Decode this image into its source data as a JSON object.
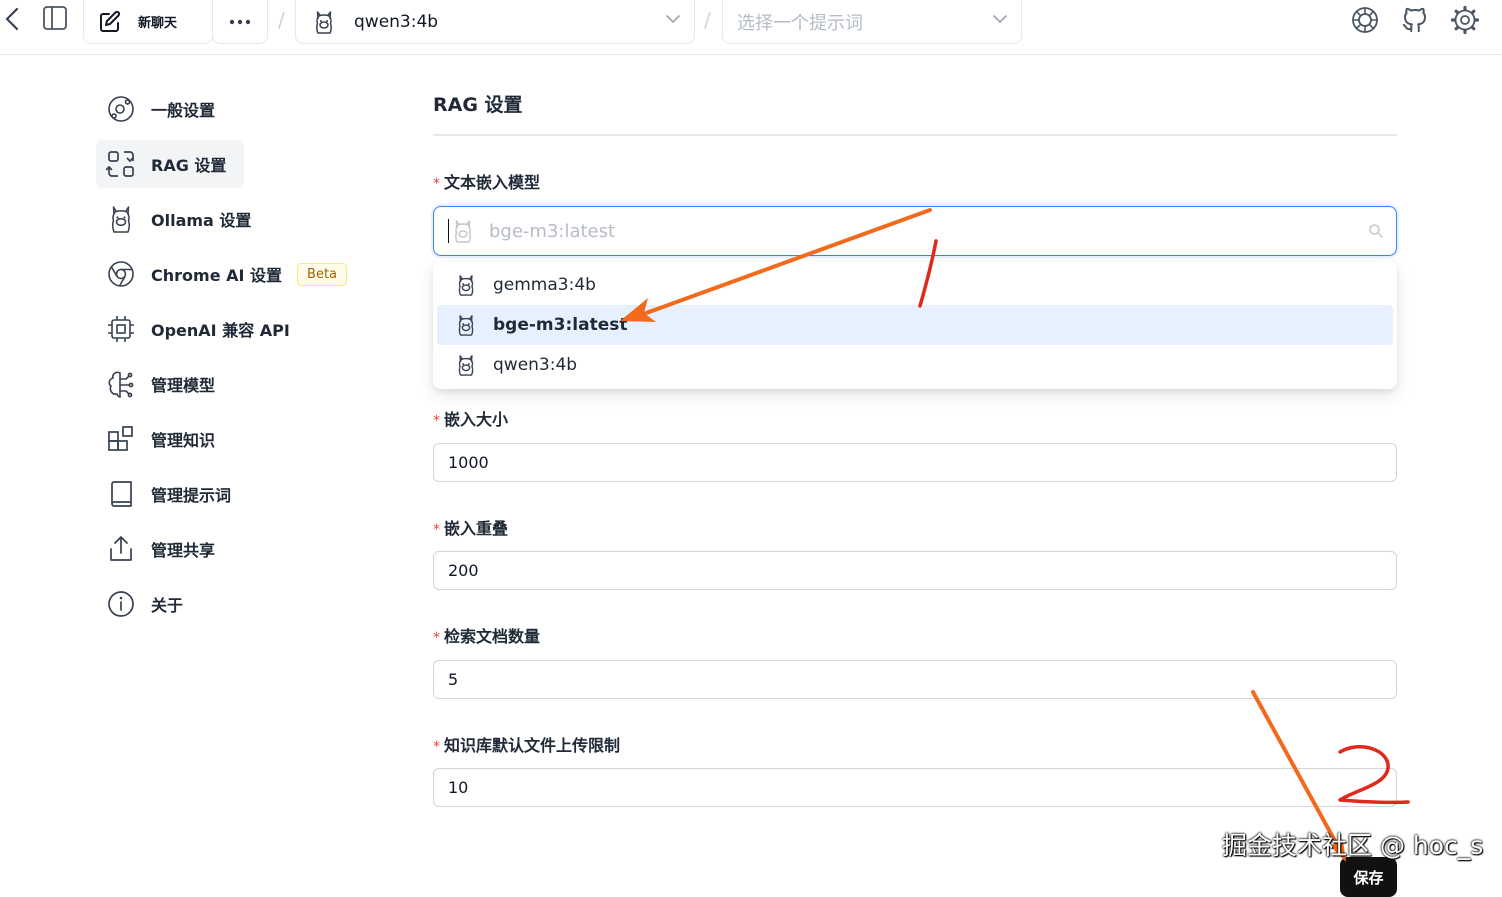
{
  "topbar": {
    "new_chat_label": "新聊天",
    "model_select": "qwen3:4b",
    "prompt_placeholder": "选择一个提示词",
    "separator": "/"
  },
  "sidebar": {
    "items": [
      {
        "label": "一般设置",
        "icon": "general-settings-icon"
      },
      {
        "label": "RAG 设置",
        "icon": "rag-icon",
        "active": true
      },
      {
        "label": "Ollama 设置",
        "icon": "ollama-icon"
      },
      {
        "label": "Chrome AI 设置",
        "icon": "chrome-icon",
        "badge": "Beta"
      },
      {
        "label": "OpenAI 兼容 API",
        "icon": "chip-icon"
      },
      {
        "label": "管理模型",
        "icon": "brain-icon"
      },
      {
        "label": "管理知识",
        "icon": "blocks-icon"
      },
      {
        "label": "管理提示词",
        "icon": "book-icon"
      },
      {
        "label": "管理共享",
        "icon": "share-icon"
      },
      {
        "label": "关于",
        "icon": "info-icon"
      }
    ]
  },
  "main": {
    "title": "RAG 设置",
    "embedding_model": {
      "label": "文本嵌入模型",
      "placeholder": "bge-m3:latest",
      "options": [
        "gemma3:4b",
        "bge-m3:latest",
        "qwen3:4b"
      ],
      "selected": "bge-m3:latest"
    },
    "chunk_size": {
      "label": "嵌入大小",
      "value": "1000"
    },
    "chunk_overlap": {
      "label": "嵌入重叠",
      "value": "200"
    },
    "retrieval_count": {
      "label": "检索文档数量",
      "value": "5"
    },
    "upload_limit": {
      "label": "知识库默认文件上传限制",
      "value": "10"
    },
    "save_label": "保存"
  },
  "watermark": "掘金技术社区 @ hoc_s",
  "colors": {
    "accent": "#3b82f6",
    "selected_bg": "#e6f0ff",
    "arrow": "#f26a1b",
    "annotation": "#e0291d",
    "required": "#ef4444"
  }
}
